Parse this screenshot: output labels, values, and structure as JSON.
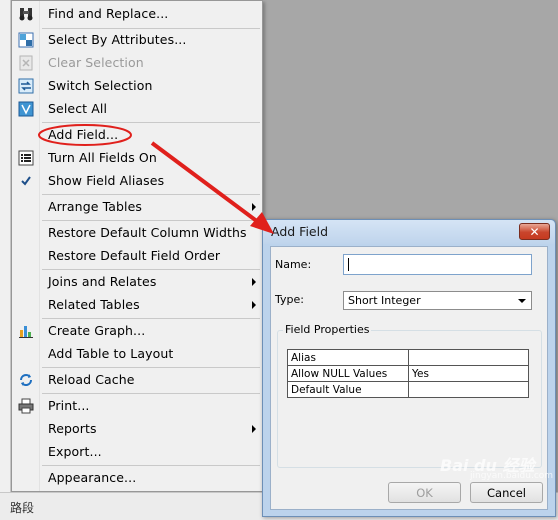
{
  "menu": {
    "items": [
      {
        "label": "Find and Replace...",
        "icon": "binoculars-icon",
        "enabled": true
      },
      {
        "label": "Select By Attributes...",
        "icon": "select-attributes-icon",
        "enabled": true
      },
      {
        "label": "Clear Selection",
        "icon": "clear-selection-icon",
        "enabled": false
      },
      {
        "label": "Switch Selection",
        "icon": "switch-selection-icon",
        "enabled": true
      },
      {
        "label": "Select All",
        "icon": "select-all-icon",
        "enabled": true
      },
      {
        "label": "Add Field...",
        "icon": "",
        "enabled": true
      },
      {
        "label": "Turn All Fields On",
        "icon": "fields-list-icon",
        "enabled": true
      },
      {
        "label": "Show Field Aliases",
        "icon": "checkmark-icon",
        "enabled": true,
        "checked": true
      },
      {
        "label": "Arrange Tables",
        "icon": "",
        "enabled": true,
        "submenu": true
      },
      {
        "label": "Restore Default Column Widths",
        "icon": "",
        "enabled": true
      },
      {
        "label": "Restore Default Field Order",
        "icon": "",
        "enabled": true
      },
      {
        "label": "Joins and Relates",
        "icon": "",
        "enabled": true,
        "submenu": true
      },
      {
        "label": "Related Tables",
        "icon": "",
        "enabled": true,
        "submenu": true
      },
      {
        "label": "Create Graph...",
        "icon": "bar-chart-icon",
        "enabled": true
      },
      {
        "label": "Add Table to Layout",
        "icon": "",
        "enabled": true
      },
      {
        "label": "Reload Cache",
        "icon": "refresh-icon",
        "enabled": true
      },
      {
        "label": "Print...",
        "icon": "printer-icon",
        "enabled": true
      },
      {
        "label": "Reports",
        "icon": "",
        "enabled": true,
        "submenu": true
      },
      {
        "label": "Export...",
        "icon": "",
        "enabled": true
      },
      {
        "label": "Appearance...",
        "icon": "",
        "enabled": true
      }
    ]
  },
  "dialog": {
    "title": "Add Field",
    "close_label": "✕",
    "name_label": "Name:",
    "name_value": "",
    "type_label": "Type:",
    "type_value": "Short Integer",
    "field_properties_label": "Field Properties",
    "properties": [
      {
        "key": "Alias",
        "value": ""
      },
      {
        "key": "Allow NULL Values",
        "value": "Yes"
      },
      {
        "key": "Default Value",
        "value": ""
      }
    ],
    "ok_label": "OK",
    "cancel_label": "Cancel"
  },
  "status_bar": {
    "tab_label": "路段"
  },
  "watermark": {
    "text": "Bai du 经验",
    "sub": "jingyan.baidu.com"
  },
  "colors": {
    "annotation_red": "#e0201c",
    "dialog_frame": "#bcd3ec",
    "menu_bg": "#f0f0f0"
  }
}
